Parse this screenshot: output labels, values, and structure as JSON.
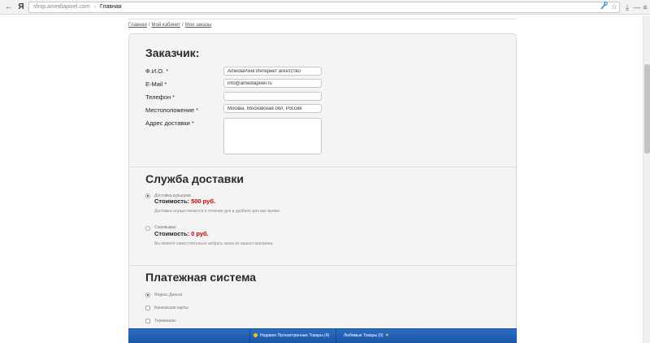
{
  "browser": {
    "back_glyph": "←",
    "logo_glyph": "Я",
    "url_domain": "shop.amediapixel.com",
    "url_sep": "›",
    "url_page": "Главная",
    "actions": [
      "search-icon",
      "star-icon",
      "download-icon",
      "minimize-icon",
      "menu-icon"
    ]
  },
  "breadcrumb": {
    "items": [
      "Главная",
      "Мой кабинет",
      "Мои заказы"
    ],
    "separator": "/"
  },
  "customer": {
    "title": "Заказчик:",
    "required_mark": "*",
    "fields": {
      "name": {
        "label": "Ф.И.О.",
        "value": "AmediaPixel Интернет агентство"
      },
      "email": {
        "label": "E-Mail",
        "value": "info@amediapixel.ru"
      },
      "phone": {
        "label": "Телефон",
        "value": ""
      },
      "location": {
        "label": "Местоположение",
        "value": "Москва, Московская обл, Россия"
      },
      "address": {
        "label": "Адрес доставки",
        "value": ""
      }
    }
  },
  "delivery": {
    "title": "Служба доставки",
    "cost_label": "Стоимость:",
    "options": [
      {
        "name": "Доставка курьером",
        "price": "500 руб.",
        "desc": "Доставка осуществляется в течение дня в удобное для вас время.",
        "selected": true
      },
      {
        "name": "Самовывоз",
        "price": "0 руб.",
        "desc": "Вы можете самостоятельно забрать заказ из нашего магазина.",
        "selected": false
      }
    ]
  },
  "payment": {
    "title": "Платежная система",
    "options": [
      {
        "name": "Яндекс.Деньги",
        "selected": true
      },
      {
        "name": "Банковские карты",
        "selected": false
      },
      {
        "name": "Терминалы",
        "selected": false
      }
    ]
  },
  "bottom_bar": {
    "recent": "Недавно Просмотренные Товары (4)",
    "favorites": "Любимые Товары (0)",
    "heart_glyph": "♥"
  },
  "colors": {
    "price": "#c00000",
    "required": "#d00000",
    "bottom_bar": "#2164b6",
    "accent_icon": "#f6c20a"
  }
}
